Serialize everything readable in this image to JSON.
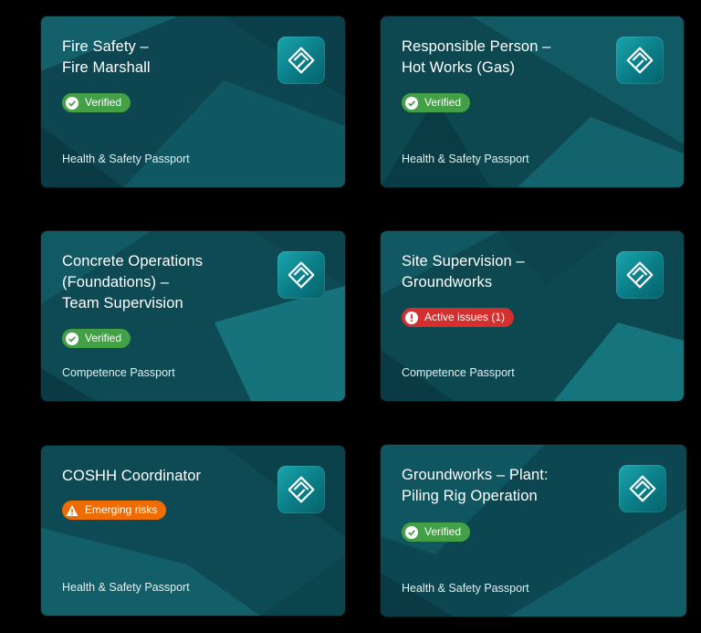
{
  "colors": {
    "page_background": "#000000",
    "card_background": "#0f4c57",
    "verified": "#43a047",
    "active_issues": "#d32f2f",
    "emerging_risks": "#ef6c00"
  },
  "cards": [
    {
      "title_lines": [
        "Fire Safety –",
        "Fire Marshall"
      ],
      "badge": {
        "label": "Verified",
        "status": "verified",
        "icon": "check-circle-icon"
      },
      "passport": "Health & Safety Passport",
      "logo_icon": "passport-logo-icon"
    },
    {
      "title_lines": [
        "Responsible Person –",
        "Hot Works (Gas)"
      ],
      "badge": {
        "label": "Verified",
        "status": "verified",
        "icon": "check-circle-icon"
      },
      "passport": "Health & Safety Passport",
      "logo_icon": "passport-logo-icon"
    },
    {
      "title_lines": [
        "Concrete Operations",
        "(Foundations) –",
        "Team Supervision"
      ],
      "badge": {
        "label": "Verified",
        "status": "verified",
        "icon": "check-circle-icon"
      },
      "passport": "Competence Passport",
      "logo_icon": "passport-logo-icon"
    },
    {
      "title_lines": [
        "Site Supervision –",
        "Groundworks"
      ],
      "badge": {
        "label": "Active issues (1)",
        "status": "issues",
        "icon": "alert-circle-icon"
      },
      "passport": "Competence Passport",
      "logo_icon": "passport-logo-icon"
    },
    {
      "title_lines": [
        "COSHH Coordinator"
      ],
      "badge": {
        "label": "Emerging risks",
        "status": "risks",
        "icon": "warning-triangle-icon"
      },
      "passport": "Health & Safety Passport",
      "logo_icon": "passport-logo-icon"
    },
    {
      "title_lines": [
        "Groundworks – Plant:",
        "Piling Rig Operation"
      ],
      "badge": {
        "label": "Verified",
        "status": "verified",
        "icon": "check-circle-icon"
      },
      "passport": "Health & Safety Passport",
      "logo_icon": "passport-logo-icon"
    }
  ]
}
